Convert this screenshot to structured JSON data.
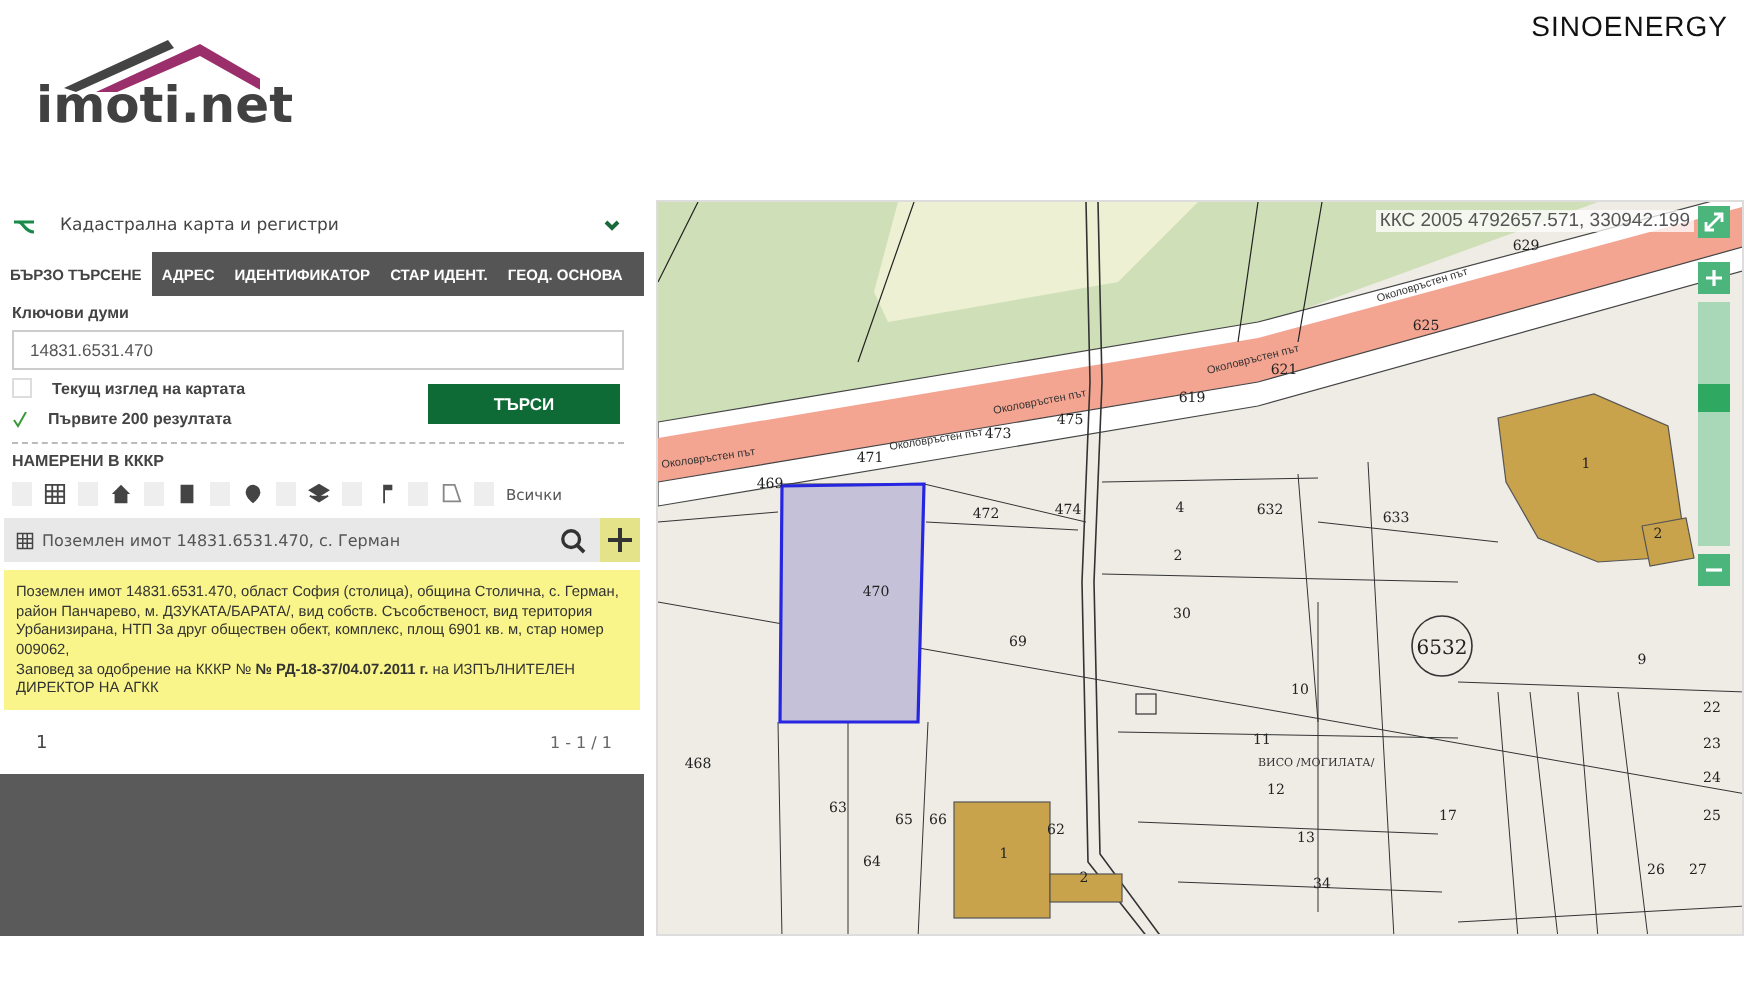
{
  "branding": {
    "logo": "imoti.net",
    "corner_text": "SINOENERGY"
  },
  "panel": {
    "title": "Кадастрална карта и регистри",
    "tabs": [
      {
        "label": "БЪРЗО ТЪРСЕНЕ",
        "selected": true
      },
      {
        "label": "АДРЕС",
        "selected": false
      },
      {
        "label": "ИДЕНТИФИКАТОР",
        "selected": false
      },
      {
        "label": "СТАР ИДЕНТ.",
        "selected": false
      },
      {
        "label": "ГЕОД. ОСНОВА",
        "selected": false
      }
    ],
    "keywords_label": "Ключови думи",
    "keywords_value": "14831.6531.470",
    "options": [
      {
        "label": "Текущ изглед на картата",
        "checked": false
      },
      {
        "label": "Първите 200 резултата",
        "checked": true
      }
    ],
    "search_button": "ТЪРСИ",
    "found_heading": "НАМЕРЕНИ В КККР",
    "filter_all": "Всички",
    "result": {
      "title": "Поземлен имот 14831.6531.470, с. Герман",
      "description": [
        "Поземлен имот 14831.6531.470, област София (столица), община Столична, с. Герман, район Панчарево, м. ДЗУКАТА/БАРАТА/, вид собств. Съсобственост, вид територия Урбанизирана, НТП За друг обществен обект, комплекс, площ 6901 кв. м, стар номер 009062,",
        "Заповед за одобрение на КККР № **№ РД-18-37/04.07.2011 г.** на ИЗПЪЛНИТЕЛЕН ДИРЕКТОР НА АГКК"
      ]
    },
    "pagination": {
      "page": "1",
      "range": "1 - 1 / 1"
    }
  },
  "map": {
    "coordinates": "ККС 2005 4792657.571, 330942.199",
    "zoom": {
      "level": 0.62
    },
    "road_labels": [
      "Околовръстен път",
      "Околовръстен път",
      "Околовръстен път",
      "Околовръстен път",
      "Околовръстен път"
    ],
    "locality_label": "ВИСО /МОГИЛАТА/",
    "sheet_number": "6532",
    "parcels": [
      "629",
      "625",
      "621",
      "619",
      "473",
      "475",
      "471",
      "469",
      "472",
      "474",
      "4",
      "2",
      "30",
      "632",
      "633",
      "470",
      "69",
      "9",
      "10",
      "11",
      "12",
      "13",
      "34",
      "17",
      "22",
      "23",
      "24",
      "25",
      "26",
      "27",
      "468",
      "63",
      "64",
      "65",
      "66",
      "62",
      "1",
      "2",
      "1",
      "2"
    ]
  }
}
